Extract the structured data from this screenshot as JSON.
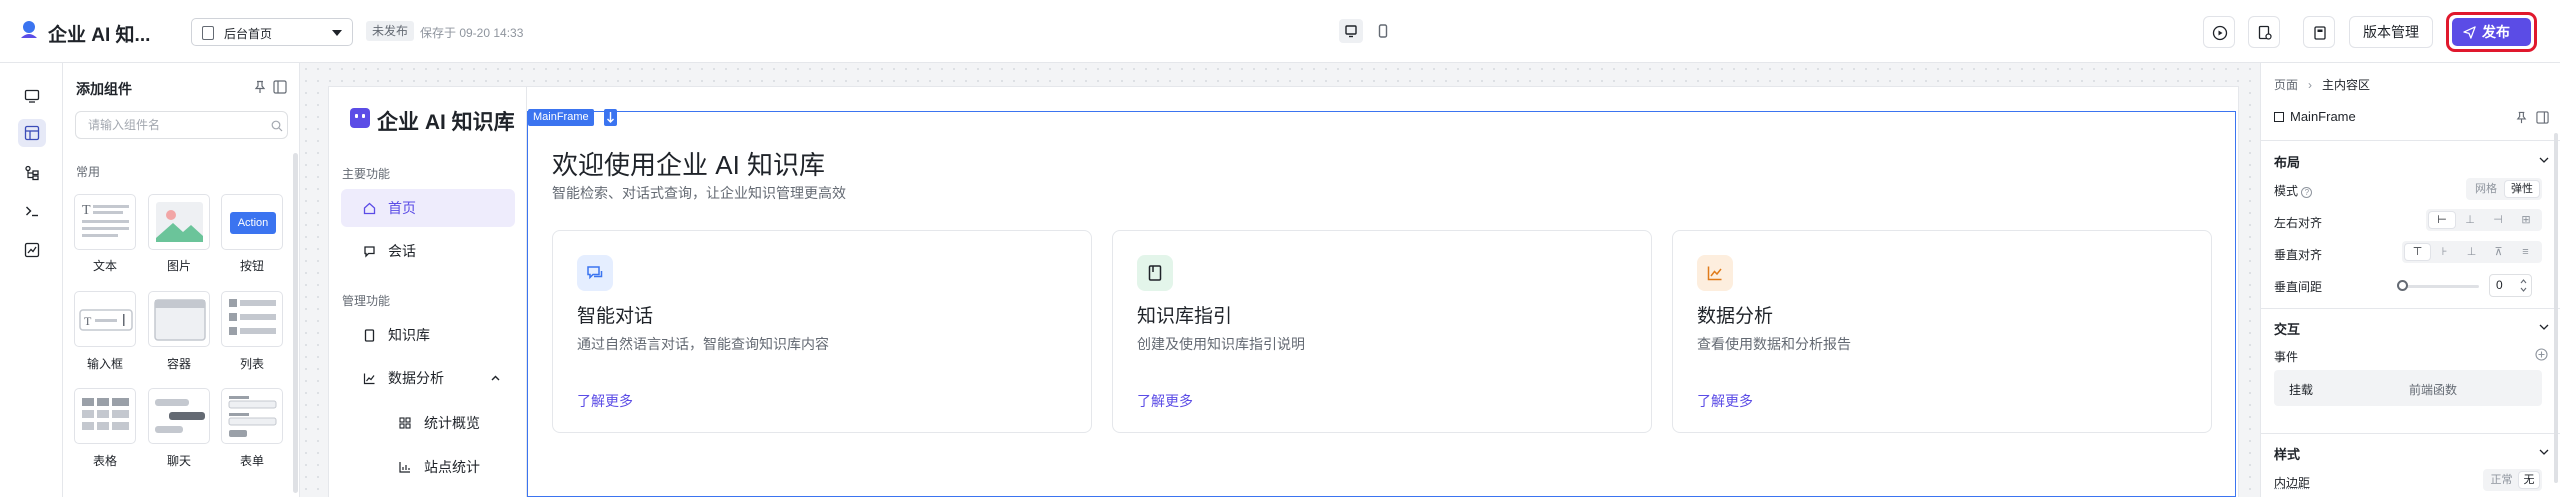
{
  "header": {
    "app_title": "企业 AI 知...",
    "page_select_value": "后台首页",
    "status_badge": "未发布",
    "save_time": "保存于 09-20 14:33",
    "version_label": "版本管理",
    "publish_label": "发布"
  },
  "component_panel": {
    "title": "添加组件",
    "search_placeholder": "请输入组件名",
    "section_label": "常用",
    "components": [
      "文本",
      "图片",
      "按钮",
      "输入框",
      "容器",
      "列表",
      "表格",
      "聊天",
      "表单"
    ],
    "button_preview_text": "Action"
  },
  "preview": {
    "app_name": "企业 AI 知识库",
    "nav_group_main": "主要功能",
    "nav_home": "首页",
    "nav_chat": "会话",
    "nav_group_manage": "管理功能",
    "nav_kb": "知识库",
    "nav_analytics": "数据分析",
    "nav_sub_overview": "统计概览",
    "nav_sub_site": "站点统计",
    "frame_tag": "MainFrame",
    "welcome_title": "欢迎使用企业 AI 知识库",
    "welcome_subtitle": "智能检索、对话式查询，让企业知识管理更高效",
    "features": [
      {
        "title": "智能对话",
        "desc": "通过自然语言对话，智能查询知识库内容",
        "link": "了解更多",
        "icon": "chat-icon",
        "color": "#3b74f0"
      },
      {
        "title": "知识库指引",
        "desc": "创建及使用知识库指引说明",
        "link": "了解更多",
        "icon": "book-icon",
        "color": "#1f9d55"
      },
      {
        "title": "数据分析",
        "desc": "查看使用数据和分析报告",
        "link": "了解更多",
        "icon": "chart-icon",
        "color": "#e07b1a"
      }
    ]
  },
  "props": {
    "crumb_page": "页面",
    "crumb_current": "主内容区",
    "frame_name": "MainFrame",
    "section_layout": "布局",
    "mode_label": "模式",
    "mode_grid": "网格",
    "mode_flex": "弹性",
    "halign_label": "左右对齐",
    "valign_label": "垂直对齐",
    "vgap_label": "垂直间距",
    "vgap_value": "0",
    "section_interact": "交互",
    "event_label": "事件",
    "event_mount": "挂载",
    "event_fn": "前端函数",
    "section_style": "样式",
    "padding_label": "内边距",
    "padding_normal": "正常",
    "padding_none": "无"
  },
  "colors": {
    "accent": "#5b4ce6",
    "frame": "#3b74f0",
    "publish_outline": "#e0182d"
  }
}
